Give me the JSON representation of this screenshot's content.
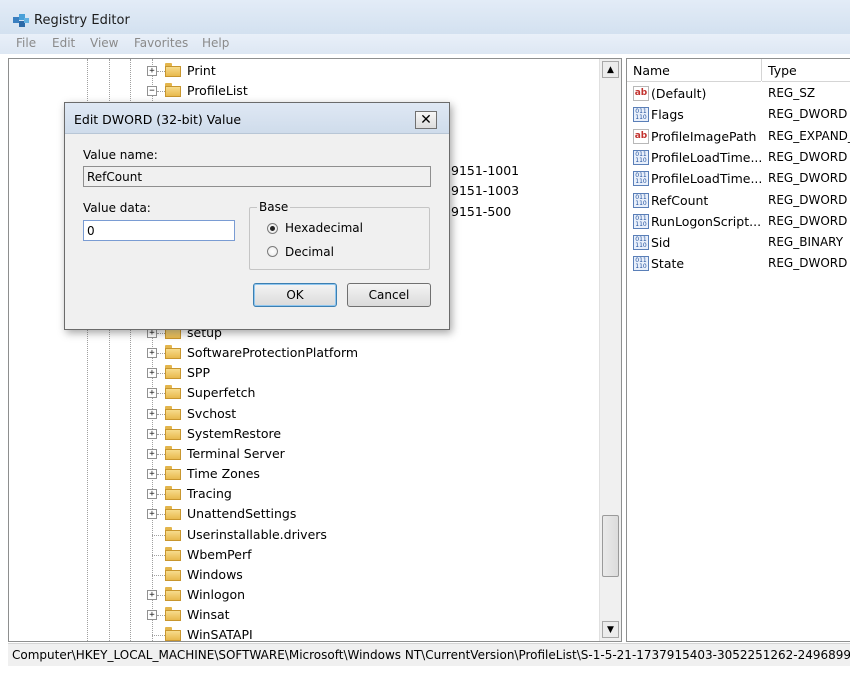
{
  "window": {
    "title": "Registry Editor"
  },
  "menu": [
    "File",
    "Edit",
    "View",
    "Favorites",
    "Help"
  ],
  "tree": {
    "top_items": [
      {
        "label": "Print",
        "expander": "+"
      },
      {
        "label": "ProfileList",
        "expander": "−"
      }
    ],
    "partial_items": [
      "9151-1001",
      "9151-1003",
      "9151-500"
    ],
    "bottom_items": [
      {
        "label": "setup",
        "expander": "+"
      },
      {
        "label": "SoftwareProtectionPlatform",
        "expander": "+"
      },
      {
        "label": "SPP",
        "expander": "+"
      },
      {
        "label": "Superfetch",
        "expander": "+"
      },
      {
        "label": "Svchost",
        "expander": "+"
      },
      {
        "label": "SystemRestore",
        "expander": "+"
      },
      {
        "label": "Terminal Server",
        "expander": "+"
      },
      {
        "label": "Time Zones",
        "expander": "+"
      },
      {
        "label": "Tracing",
        "expander": "+"
      },
      {
        "label": "UnattendSettings",
        "expander": "+"
      },
      {
        "label": "Userinstallable.drivers",
        "expander": ""
      },
      {
        "label": "WbemPerf",
        "expander": ""
      },
      {
        "label": "Windows",
        "expander": ""
      },
      {
        "label": "Winlogon",
        "expander": "+"
      },
      {
        "label": "Winsat",
        "expander": "+"
      },
      {
        "label": "WinSATAPI",
        "expander": ""
      }
    ]
  },
  "values": {
    "headers": {
      "name": "Name",
      "type": "Type"
    },
    "rows": [
      {
        "name": "(Default)",
        "type": "REG_SZ",
        "icon": "ab-string-icon"
      },
      {
        "name": "Flags",
        "type": "REG_DWORD",
        "icon": "binary-value-icon"
      },
      {
        "name": "ProfileImagePath",
        "type": "REG_EXPAND_",
        "icon": "ab-string-icon"
      },
      {
        "name": "ProfileLoadTime...",
        "type": "REG_DWORD",
        "icon": "binary-value-icon"
      },
      {
        "name": "ProfileLoadTime...",
        "type": "REG_DWORD",
        "icon": "binary-value-icon"
      },
      {
        "name": "RefCount",
        "type": "REG_DWORD",
        "icon": "binary-value-icon"
      },
      {
        "name": "RunLogonScript...",
        "type": "REG_DWORD",
        "icon": "binary-value-icon"
      },
      {
        "name": "Sid",
        "type": "REG_BINARY",
        "icon": "binary-value-icon"
      },
      {
        "name": "State",
        "type": "REG_DWORD",
        "icon": "binary-value-icon"
      }
    ]
  },
  "status_path": "Computer\\HKEY_LOCAL_MACHINE\\SOFTWARE\\Microsoft\\Windows NT\\CurrentVersion\\ProfileList\\S-1-5-21-1737915403-3052251262-2496899",
  "dialog": {
    "title": "Edit DWORD (32-bit) Value",
    "close_glyph": "✕",
    "value_name_label": "Value name:",
    "value_name": "RefCount",
    "value_data_label": "Value data:",
    "value_data": "0",
    "base_label": "Base",
    "hex_label": "Hexadecimal",
    "dec_label": "Decimal",
    "selected_base": "Hexadecimal",
    "ok_label": "OK",
    "cancel_label": "Cancel"
  }
}
